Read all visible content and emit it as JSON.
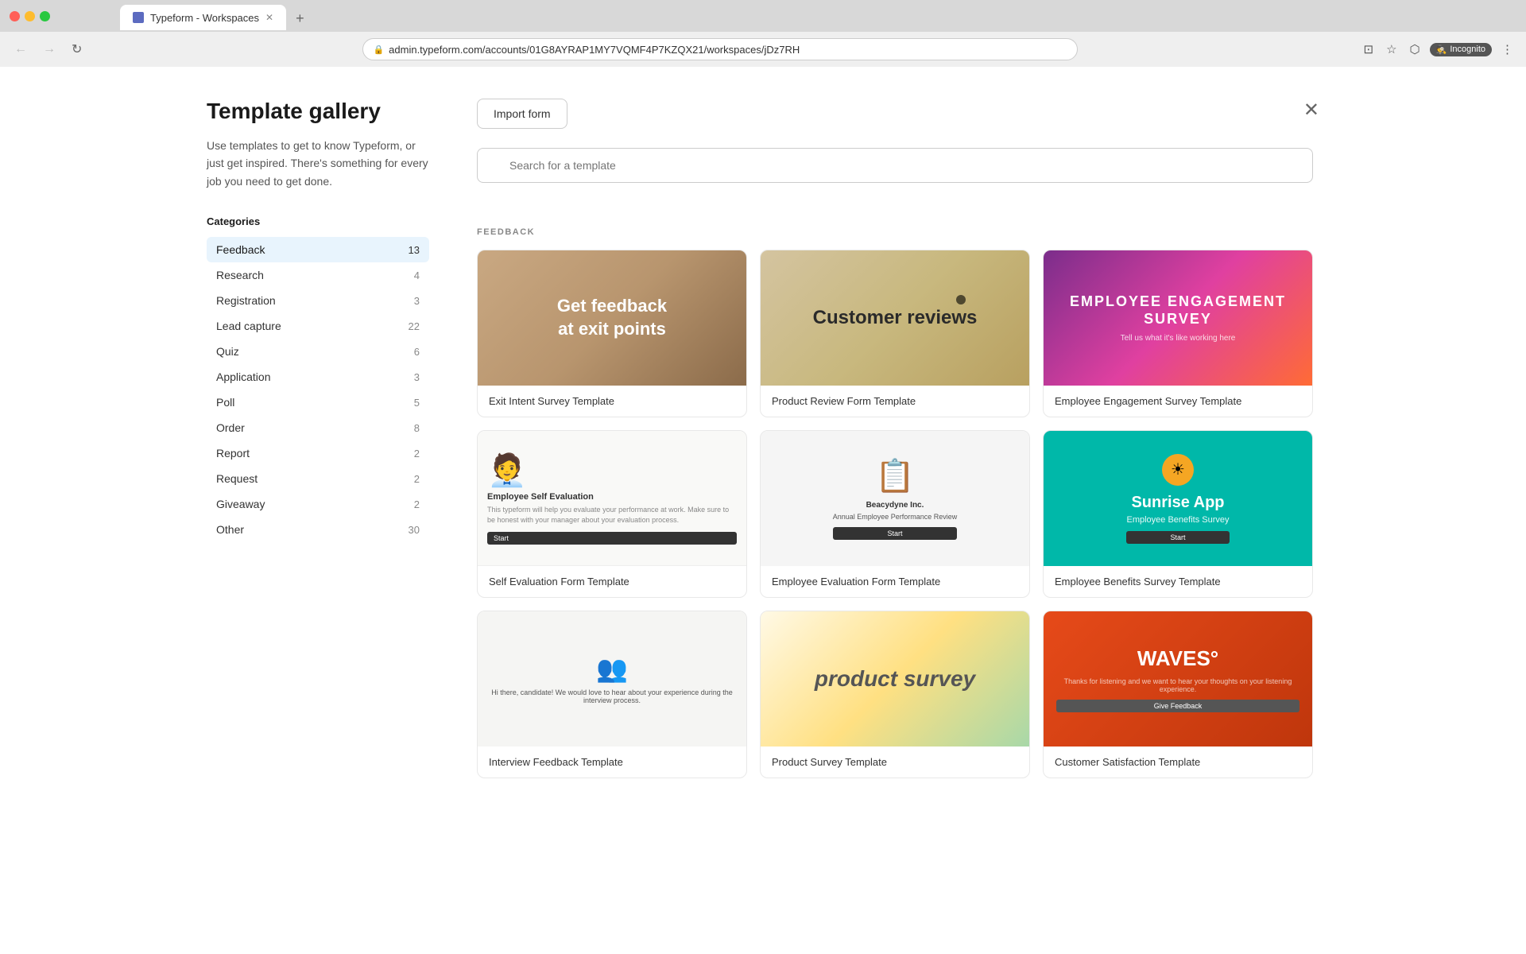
{
  "browser": {
    "tab_title": "Typeform - Workspaces",
    "tab_new_label": "+",
    "url": "admin.typeform.com/accounts/01G8AYRAP1MY7VQMF4P7KZQX21/workspaces/jDz7RH",
    "nav_back": "←",
    "nav_forward": "→",
    "nav_reload": "↻",
    "incognito_label": "Incognito",
    "more_options": "⋮"
  },
  "modal": {
    "close_label": "✕",
    "title": "Template gallery",
    "description": "Use templates to get to know Typeform, or just get inspired. There's something for every job you need to get done.",
    "import_button": "Import form",
    "search_placeholder": "Search for a template",
    "feedback_section_label": "FEEDBACK"
  },
  "categories": {
    "title": "Categories",
    "items": [
      {
        "label": "Feedback",
        "count": "13",
        "active": true
      },
      {
        "label": "Research",
        "count": "4",
        "active": false
      },
      {
        "label": "Registration",
        "count": "3",
        "active": false
      },
      {
        "label": "Lead capture",
        "count": "22",
        "active": false
      },
      {
        "label": "Quiz",
        "count": "6",
        "active": false
      },
      {
        "label": "Application",
        "count": "3",
        "active": false
      },
      {
        "label": "Poll",
        "count": "5",
        "active": false
      },
      {
        "label": "Order",
        "count": "8",
        "active": false
      },
      {
        "label": "Report",
        "count": "2",
        "active": false
      },
      {
        "label": "Request",
        "count": "2",
        "active": false
      },
      {
        "label": "Giveaway",
        "count": "2",
        "active": false
      },
      {
        "label": "Other",
        "count": "30",
        "active": false
      }
    ]
  },
  "templates": {
    "row1": [
      {
        "id": "exit-intent",
        "title": "Exit Intent Survey Template",
        "thumb_text_line1": "Get feedback",
        "thumb_text_line2": "at exit points"
      },
      {
        "id": "product-review",
        "title": "Product Review Form Template",
        "thumb_text": "Customer reviews"
      },
      {
        "id": "employee-engagement",
        "title": "Employee Engagement Survey Template",
        "thumb_text": "EMPLOYEE ENGAGEMENT SURVEY"
      }
    ],
    "row2": [
      {
        "id": "self-evaluation",
        "title": "Self Evaluation Form Template"
      },
      {
        "id": "employee-evaluation",
        "title": "Employee Evaluation Form Template"
      },
      {
        "id": "employee-benefits",
        "title": "Employee Benefits Survey Template",
        "thumb_text_line1": "Sunrise App",
        "thumb_text_line2": "Employee Benefits Survey"
      }
    ],
    "row3": [
      {
        "id": "interview",
        "title": "Interview Feedback Template"
      },
      {
        "id": "product-survey",
        "title": "Product Survey Template",
        "thumb_text": "product survey"
      },
      {
        "id": "waves",
        "title": "Customer Satisfaction Template",
        "thumb_text": "WAVES°"
      }
    ]
  }
}
